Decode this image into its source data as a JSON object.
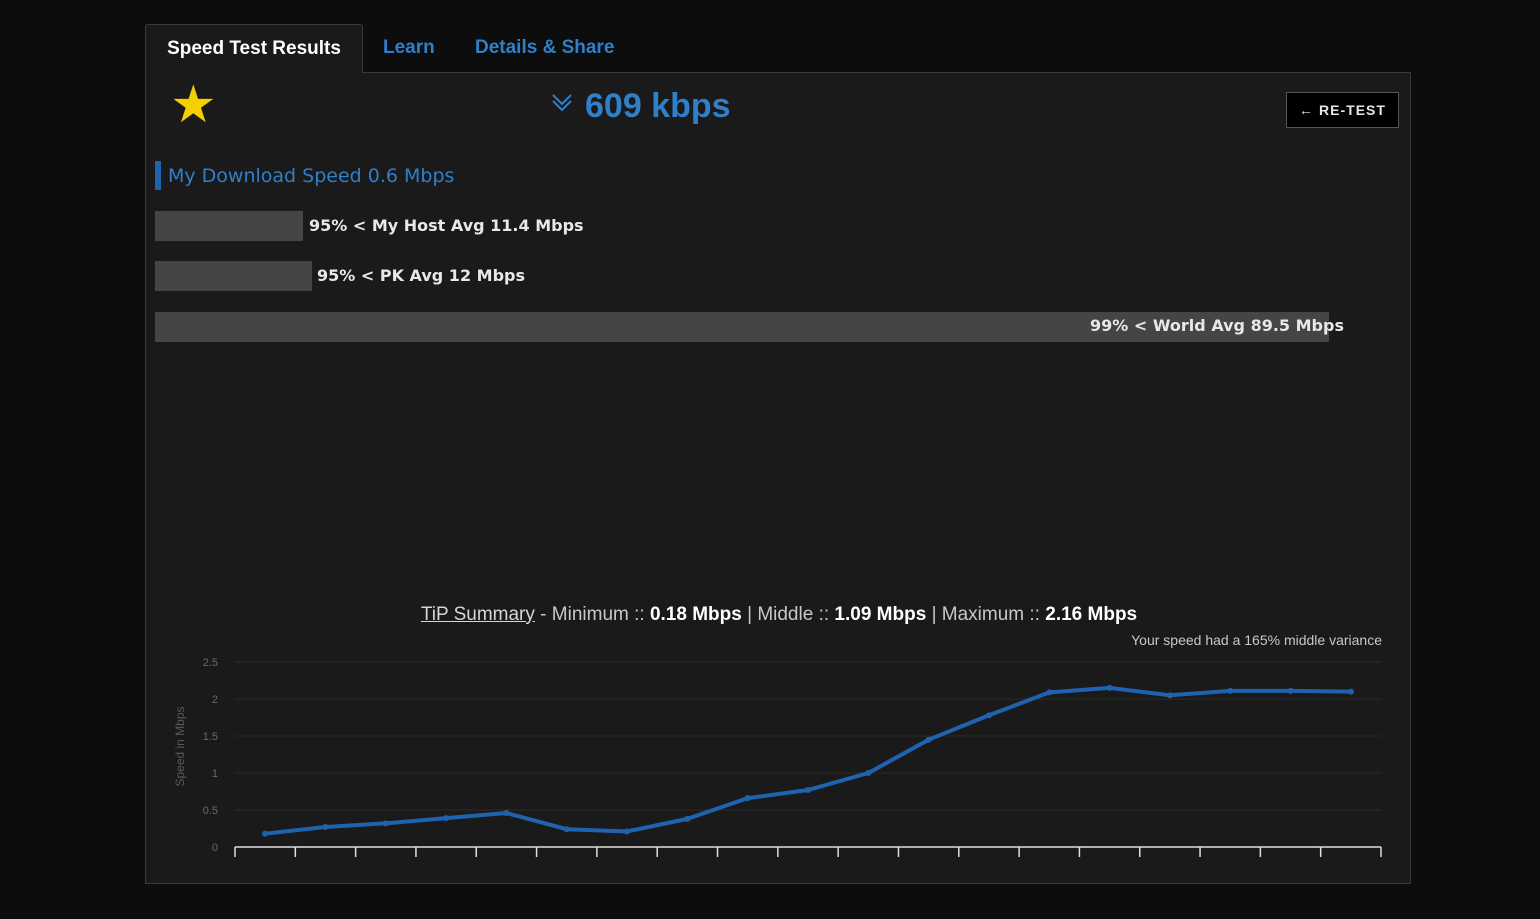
{
  "tabs": [
    {
      "label": "Speed Test Results"
    },
    {
      "label": "Learn"
    },
    {
      "label": "Details & Share"
    }
  ],
  "result": {
    "rating_icon": "star-icon",
    "direction_icon": "download-arrow-icon",
    "speed": "609 kbps",
    "retest_label": "RE-TEST",
    "retest_arrow": "←"
  },
  "comparison": {
    "my_speed": "My Download Speed 0.6 Mbps",
    "bars": [
      {
        "label": "95% < My Host Avg 11.4 Mbps",
        "value_mbps": 11.4
      },
      {
        "label": "95% < PK Avg 12 Mbps",
        "value_mbps": 12
      },
      {
        "label": "99% < World Avg 89.5 Mbps",
        "value_mbps": 89.5
      }
    ]
  },
  "summary": {
    "link": "TiP Summary",
    "min_label": " - Minimum :: ",
    "min_value": "0.18 Mbps",
    "mid_label": " | Middle :: ",
    "mid_value": "1.09 Mbps",
    "max_label": " | Maximum :: ",
    "max_value": "2.16 Mbps",
    "variance": "Your speed had a 165% middle variance"
  },
  "chart_data": {
    "type": "line",
    "ylabel": "Speed in Mbps",
    "xlabel": "",
    "ylim": [
      0,
      2.5
    ],
    "yticks": [
      "0",
      "0.5",
      "1",
      "1.5",
      "2",
      "2.5"
    ],
    "grid": true,
    "color": "#1f63b0",
    "series": [
      {
        "values": [
          0.18,
          0.27,
          0.32,
          0.39,
          0.46,
          0.24,
          0.21,
          0.38,
          0.66,
          0.77,
          1.0,
          1.45,
          1.78,
          2.09,
          2.15,
          2.05,
          2.11,
          2.11,
          2.1
        ]
      }
    ]
  }
}
